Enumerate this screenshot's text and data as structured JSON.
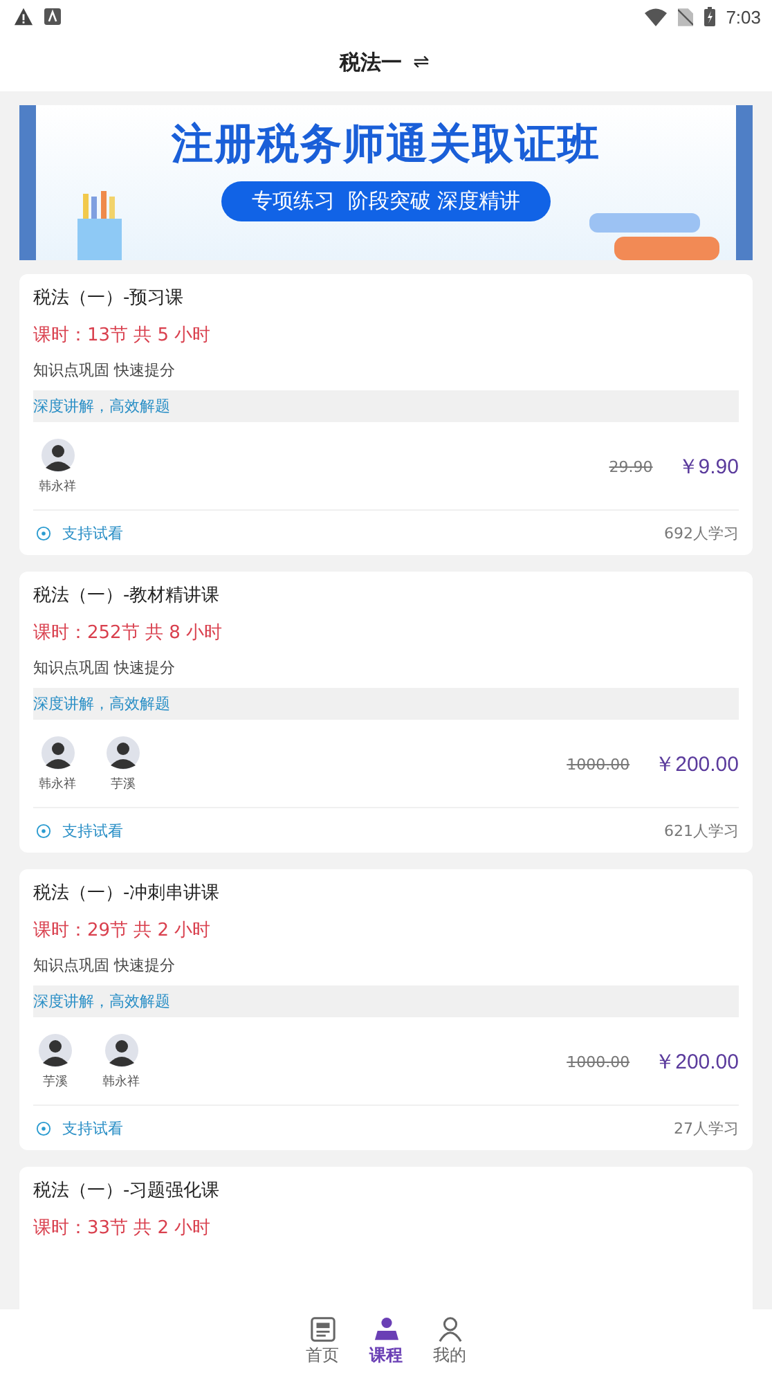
{
  "status_bar": {
    "time": "7:03"
  },
  "header": {
    "title": "税法一",
    "switch_icon": "⇌"
  },
  "banner": {
    "title": "注册税务师通关取证班",
    "subtitle": "专项练习  阶段突破 深度精讲"
  },
  "courses": [
    {
      "title": "税法（一）-预习课",
      "hours": "课时：13节 共 5 小时",
      "desc": "知识点巩固 快速提分",
      "tag": "深度讲解，高效解题",
      "teachers": [
        {
          "name": "韩永祥"
        }
      ],
      "old_price": "29.90",
      "price": "￥9.90",
      "trial": "支持试看",
      "learners": "692人学习"
    },
    {
      "title": "税法（一）-教材精讲课",
      "hours": "课时：252节 共 8 小时",
      "desc": "知识点巩固 快速提分",
      "tag": "深度讲解，高效解题",
      "teachers": [
        {
          "name": "韩永祥"
        },
        {
          "name": "芋溪"
        }
      ],
      "old_price": "1000.00",
      "price": "￥200.00",
      "trial": "支持试看",
      "learners": "621人学习"
    },
    {
      "title": "税法（一）-冲刺串讲课",
      "hours": "课时：29节 共 2 小时",
      "desc": "知识点巩固 快速提分",
      "tag": "深度讲解，高效解题",
      "teachers": [
        {
          "name": "芋溪"
        },
        {
          "name": "韩永祥"
        }
      ],
      "old_price": "1000.00",
      "price": "￥200.00",
      "trial": "支持试看",
      "learners": "27人学习"
    },
    {
      "title": "税法（一）-习题强化课",
      "hours": "课时：33节 共 2 小时"
    }
  ],
  "nav": [
    {
      "label": "首页",
      "selected": false
    },
    {
      "label": "课程",
      "selected": true
    },
    {
      "label": "我的",
      "selected": false
    }
  ]
}
